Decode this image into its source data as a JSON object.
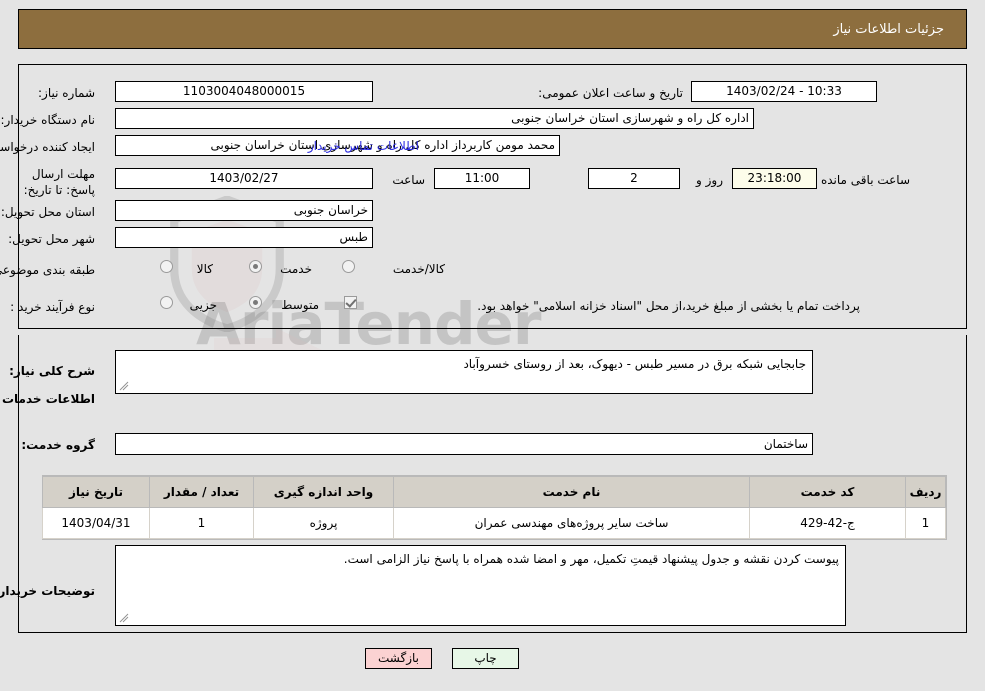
{
  "header": {
    "title": "جزئیات اطلاعات نیاز"
  },
  "colors": {
    "header_bar": "#8d6e3e",
    "page_bg": "#e4e4e4",
    "link": "#2b2be0",
    "countdown_bg": "#fdfdea",
    "print_btn_bg": "#e7f7e7",
    "back_btn_bg": "#fbd2d2",
    "table_header_bg": "#d4d0c8"
  },
  "summary": {
    "need_number_label": "شماره نیاز:",
    "need_number_value": "1103004048000015",
    "announce_datetime_label": "تاریخ و ساعت اعلان عمومی:",
    "announce_datetime_value": "10:33 - 1403/02/24",
    "buyer_org_label": "نام دستگاه خریدار:",
    "buyer_org_value": "اداره کل راه و شهرسازی استان خراسان جنوبی",
    "requester_label": "ایجاد کننده درخواست:",
    "requester_value": "محمد مومن کاربرداز اداره کل راه و شهرسازی استان خراسان جنوبی",
    "buyer_contact_link": "اطلاعات تماس خریدار",
    "deadline_label": "مهلت ارسال پاسخ: تا تاریخ:",
    "deadline_date_value": "1403/02/27",
    "deadline_hour_label": "ساعت",
    "deadline_hour_value": "11:00",
    "remaining_days_value": "2",
    "remaining_days_suffix": "روز و",
    "remaining_time_value": "23:18:00",
    "remaining_time_suffix": "ساعت باقی مانده",
    "delivery_province_label": "استان محل تحویل:",
    "delivery_province_value": "خراسان جنوبی",
    "delivery_city_label": "شهر محل تحویل:",
    "delivery_city_value": "طبس",
    "subject_category_label": "طبقه بندی موضوعی:",
    "subject_category_options": [
      {
        "label": "کالا",
        "selected": false
      },
      {
        "label": "خدمت",
        "selected": true
      },
      {
        "label": "کالا/خدمت",
        "selected": false
      }
    ],
    "purchase_process_label": "نوع فرآیند خرید :",
    "purchase_process_options": [
      {
        "label": "جزیی",
        "selected": false
      },
      {
        "label": "متوسط",
        "selected": true
      }
    ],
    "treasury_checkbox_checked": true,
    "treasury_note": "پرداخت تمام یا بخشی از مبلغ خرید،از محل \"اسناد خزانه اسلامی\" خواهد بود."
  },
  "need_description": {
    "label": "شرح کلی نیاز:",
    "value": "جابجایی شبکه برق در مسیر طبس - دیهوک، بعد از روستای خسروآباد"
  },
  "services_section": {
    "heading": "اطلاعات خدمات مورد نیاز",
    "service_group_label": "گروه خدمت:",
    "service_group_value": "ساختمان"
  },
  "services_table": {
    "columns": [
      "ردیف",
      "کد خدمت",
      "نام خدمت",
      "واحد اندازه گیری",
      "تعداد / مقدار",
      "تاریخ نیاز"
    ],
    "rows": [
      {
        "row_no": "1",
        "service_code": "ج-42-429",
        "service_name": "ساخت سایر پروژه‌های مهندسی عمران",
        "unit": "پروژه",
        "quantity": "1",
        "need_date": "1403/04/31"
      }
    ]
  },
  "buyer_notes": {
    "label": "توضیحات خریدار:",
    "value": "پیوست کردن نقشه و جدول پیشنهاد قیمتِ تکمیل، مهر و امضا شده همراه با پاسخ نیاز الزامی است."
  },
  "footer": {
    "print_label": "چاپ",
    "back_label": "بازگشت"
  }
}
